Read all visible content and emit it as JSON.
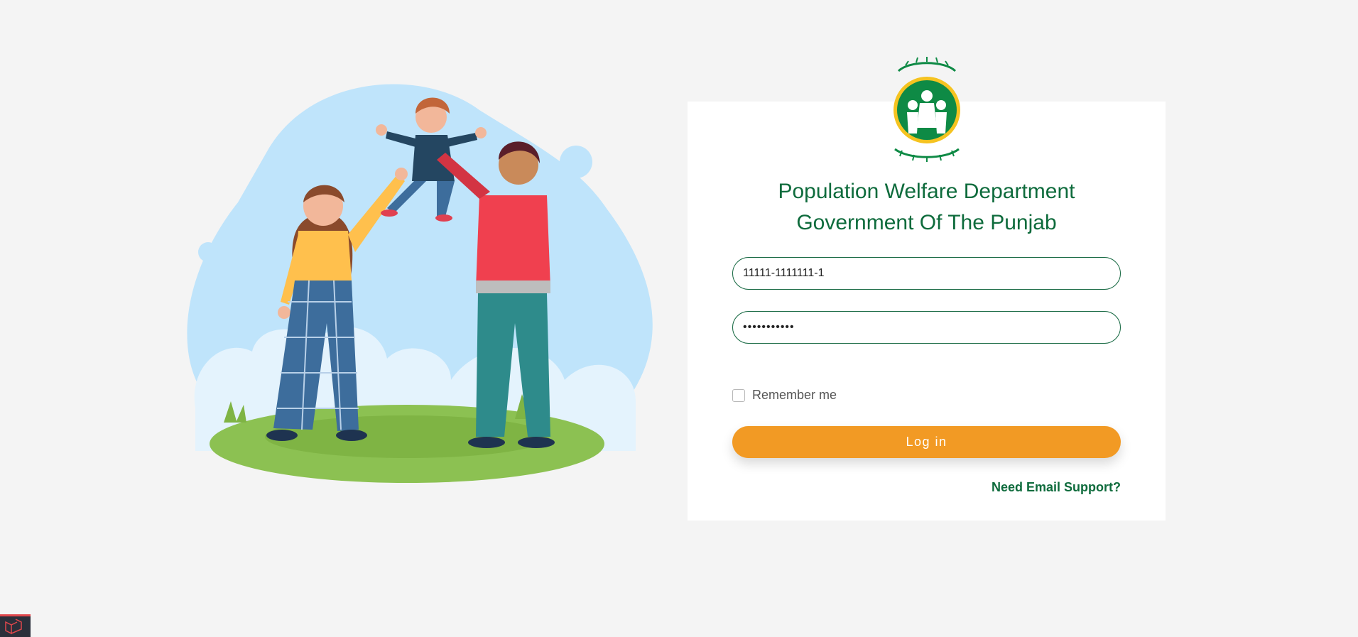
{
  "header": {
    "title_line1": "Population Welfare Department",
    "title_line2": "Government Of The Punjab"
  },
  "form": {
    "cnic_value": "11111-1111111-1",
    "password_value": "•••••••••••",
    "remember_label": "Remember me",
    "login_label": "Log in",
    "support_link": "Need Email Support?"
  },
  "colors": {
    "brand_green": "#0e6b3c",
    "accent_orange": "#f29a24",
    "background": "#f4f4f4"
  },
  "icons": {
    "logo": "family-welfare-logo-icon",
    "debug": "laravel-debugbar-icon"
  }
}
